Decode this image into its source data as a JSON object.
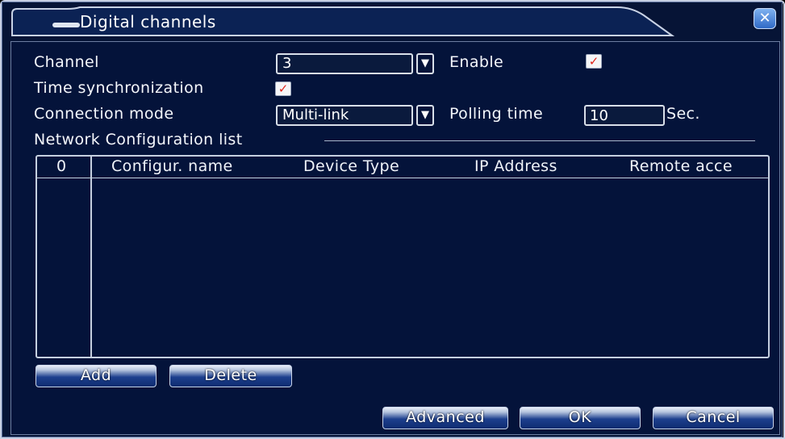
{
  "dialog": {
    "title": "Digital channels",
    "close_symbol": "✕"
  },
  "form": {
    "channel_label": "Channel",
    "channel_value": "3",
    "enable_label": "Enable",
    "enable_checked": true,
    "time_sync_label": "Time synchronization",
    "time_sync_checked": true,
    "connection_mode_label": "Connection mode",
    "connection_mode_value": "Multi-link",
    "polling_time_label": "Polling time",
    "polling_time_value": "10",
    "polling_unit": "Sec.",
    "check_mark": "✓",
    "dropdown_arrow": "▼"
  },
  "network_list": {
    "group_label": "Network Configuration list",
    "columns": [
      "0",
      "Configur. name",
      "Device Type",
      "IP Address",
      "Remote acce"
    ],
    "rows": []
  },
  "buttons": {
    "add": "Add",
    "delete": "Delete",
    "advanced": "Advanced",
    "ok": "OK",
    "cancel": "Cancel"
  },
  "colors": {
    "background": "#061436",
    "text": "#ffffff",
    "check_mark": "#e0241b",
    "button_dark": "#0e2c70"
  }
}
